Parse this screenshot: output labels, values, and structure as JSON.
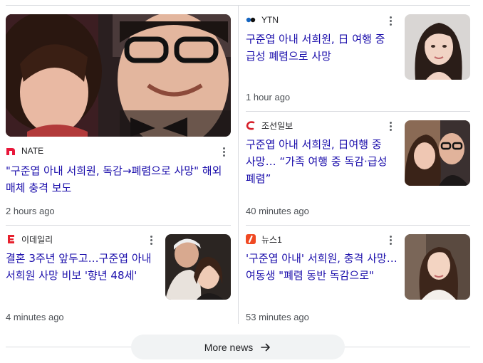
{
  "articles": [
    {
      "source": "NATE",
      "headline": "\"구준엽 아내 서희원, 독감→폐렴으로 사망\" 해외 매체 충격 보도",
      "time": "2 hours ago"
    },
    {
      "source": "YTN",
      "headline": "구준엽 아내 서희원, 日 여행 중 급성 폐렴으로 사망",
      "time": "1 hour ago"
    },
    {
      "source": "조선일보",
      "headline": "구준엽 아내 서희원, 日여행 중 사망… “가족 여행 중 독감·급성 폐렴”",
      "time": "40 minutes ago"
    },
    {
      "source": "이데일리",
      "headline": "결혼 3주년 앞두고…구준엽 아내 서희원 사망 비보 '향년 48세'",
      "time": "4 minutes ago"
    },
    {
      "source": "뉴스1",
      "headline": "'구준엽 아내' 서희원, 충격 사망… 여동생 \"폐렴 동반 독감으로\"",
      "time": "53 minutes ago"
    }
  ],
  "more_news": {
    "label": "More news"
  },
  "icons": {
    "more": "more-vert-icon",
    "arrow": "arrow-right-icon"
  },
  "colors": {
    "headline": "#1a0dab",
    "nate_red": "#e8173a",
    "ytn_blue": "#1565c0",
    "chosun_red": "#d6202a",
    "edaily_red": "#e7212d",
    "news1_red": "#f04923"
  }
}
